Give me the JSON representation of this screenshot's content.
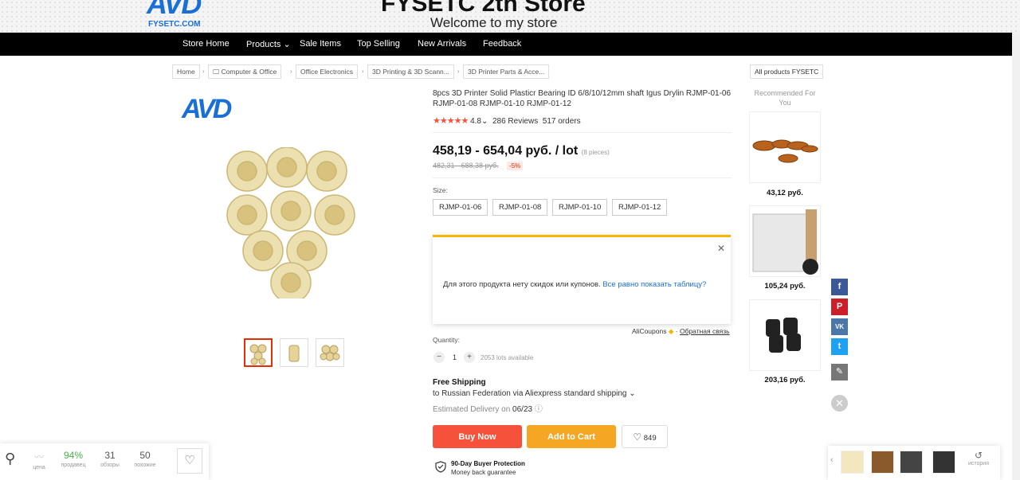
{
  "banner": {
    "logo": "AVD",
    "logo_sub": "FYSETC.COM",
    "store_name": "FYSETC 2th Store",
    "welcome": "Welcome to my store"
  },
  "nav": {
    "items": [
      "Store Home",
      "Products",
      "Sale Items",
      "Top Selling",
      "New Arrivals",
      "Feedback"
    ]
  },
  "breadcrumb": [
    "Home",
    "Computer & Office",
    "Office Electronics",
    "3D Printing & 3D Scann...",
    "3D Printer Parts & Acce..."
  ],
  "all_products": "All products FYSETC",
  "product": {
    "logo": "AVD",
    "title": "8pcs 3D Printer Solid Plasticr Bearing ID 6/8/10/12mm shaft Igus Drylin RJMP-01-06 RJMP-01-08 RJMP-01-10 RJMP-01-12",
    "stars": "★★★★★",
    "rating": "4.8",
    "reviews": "286 Reviews",
    "orders": "517 orders",
    "price": "458,19 - 654,04 руб. / lot",
    "pieces": "(8 pieces)",
    "old_price": "482,31 - 688,38 руб.",
    "discount": "-5%",
    "size_label": "Size:",
    "sizes": [
      "RJMP-01-06",
      "RJMP-01-08",
      "RJMP-01-10",
      "RJMP-01-12"
    ],
    "coupon_msg": "Для этого продукта нету скидок или купонов.",
    "coupon_link": "Все равно показать таблицу?",
    "alicoupons": "AliCoupons",
    "feedback_link": "Обратная связь",
    "quantity_label": "Quantity:",
    "quantity": "1",
    "lots_available": "2053 lots available",
    "shipping_title": "Free Shipping",
    "shipping_to": "to Russian Federation via Aliexpress standard shipping",
    "estimated": "Estimated Delivery on",
    "estimated_date": "06/23",
    "buy_now": "Buy Now",
    "add_to_cart": "Add to Cart",
    "wishlist_count": "849",
    "protection_title": "90-Day Buyer Protection",
    "protection_sub": "Money back guarantee"
  },
  "recommended": {
    "title": "Recommended For You",
    "items": [
      {
        "price": "43,12 руб."
      },
      {
        "price": "105,24 руб."
      },
      {
        "price": "203,16 руб."
      }
    ]
  },
  "stats": {
    "price_label": "цена",
    "sellers_value": "94%",
    "sellers_label": "продавец",
    "reviews_value": "31",
    "reviews_label": "обзоры",
    "similar_value": "50",
    "similar_label": "похожие"
  },
  "history": {
    "label": "история"
  },
  "colors": {
    "buy": "#f5513b",
    "cart": "#f5a623",
    "accent": "#1a6fd6",
    "coupon_border": "#f5b500"
  }
}
